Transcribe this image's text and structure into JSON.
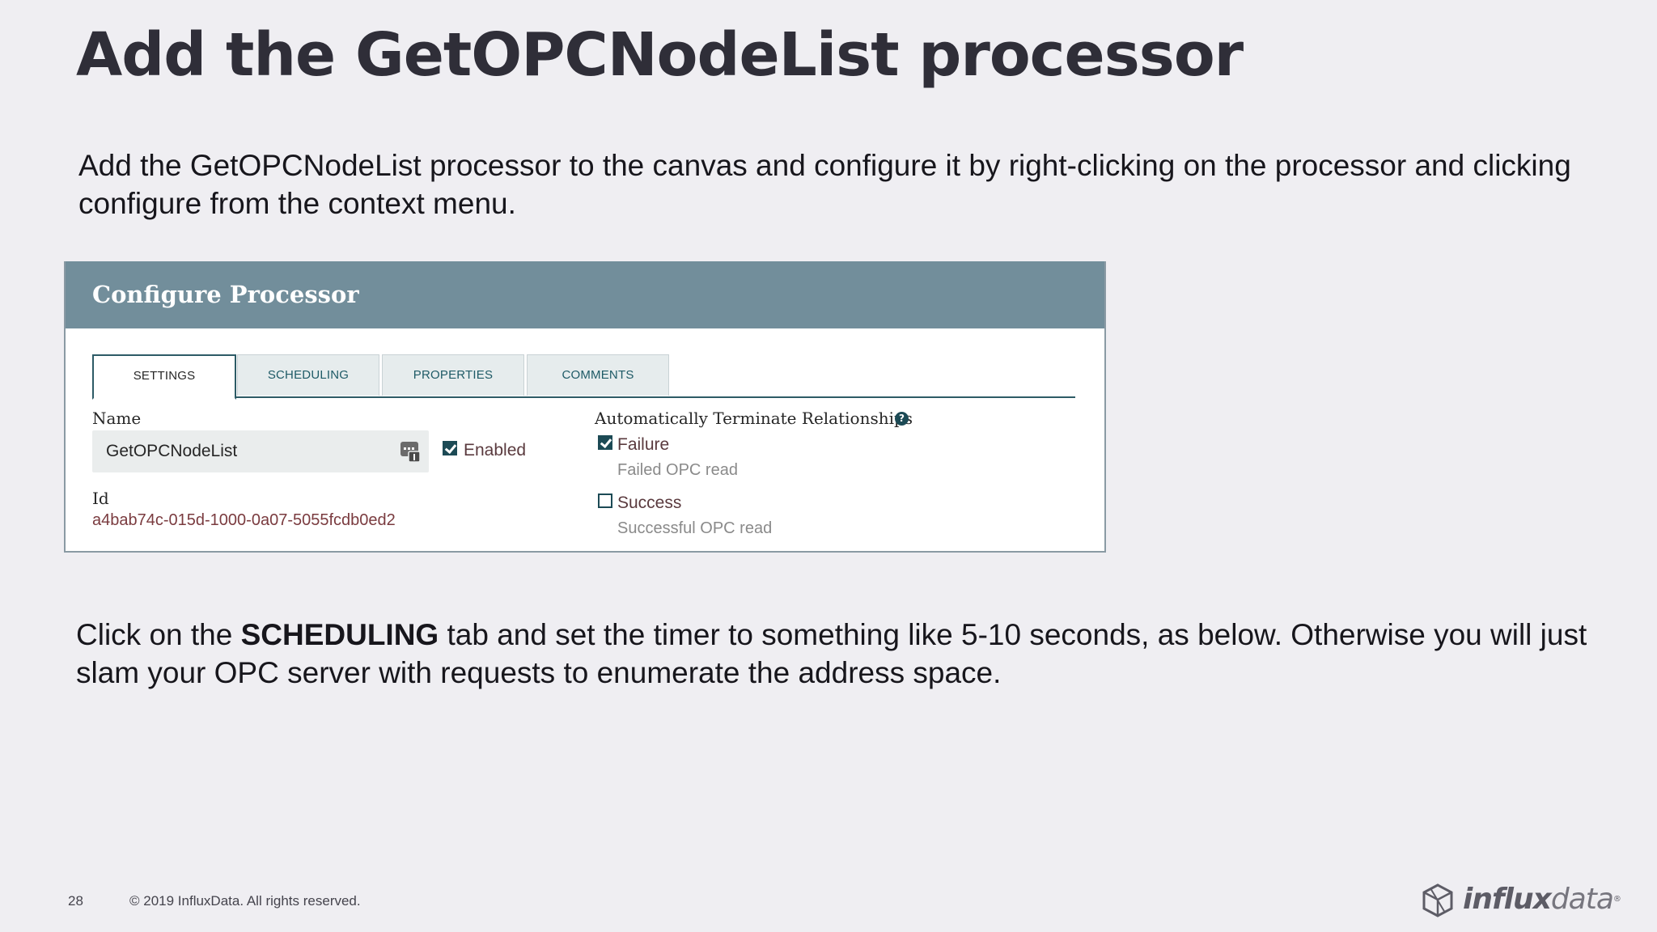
{
  "slide": {
    "title": "Add the GetOPCNodeList processor",
    "intro": "Add the GetOPCNodeList processor to the canvas and configure it by right-clicking on the processor and clicking configure from the context menu.",
    "instruction_prefix": "Click on the ",
    "instruction_bold": "SCHEDULING",
    "instruction_suffix": " tab and set the timer to something like 5-10 seconds, as below. Otherwise you will just slam your OPC server with requests to enumerate the address space."
  },
  "dialog": {
    "title": "Configure Processor",
    "tabs": [
      {
        "label": "SETTINGS",
        "active": true
      },
      {
        "label": "SCHEDULING",
        "active": false
      },
      {
        "label": "PROPERTIES",
        "active": false
      },
      {
        "label": "COMMENTS",
        "active": false
      }
    ],
    "name_label": "Name",
    "name_value": "GetOPCNodeList",
    "enabled_label": "Enabled",
    "enabled_checked": true,
    "id_label": "Id",
    "id_value": "a4bab74c-015d-1000-0a07-5055fcdb0ed2",
    "auto_terminate_label": "Automatically Terminate Relationships",
    "help_icon": "?",
    "relationships": [
      {
        "name": "Failure",
        "checked": true,
        "description": "Failed OPC read"
      },
      {
        "name": "Success",
        "checked": false,
        "description": "Successful OPC read"
      }
    ]
  },
  "footer": {
    "page_number": "28",
    "copyright": "© 2019 InfluxData. All rights reserved.",
    "logo_bold": "influx",
    "logo_light": "data",
    "logo_mark": "®"
  },
  "colors": {
    "background": "#efeef2",
    "dialog_header": "#728e9b",
    "accent": "#1c4a55"
  }
}
